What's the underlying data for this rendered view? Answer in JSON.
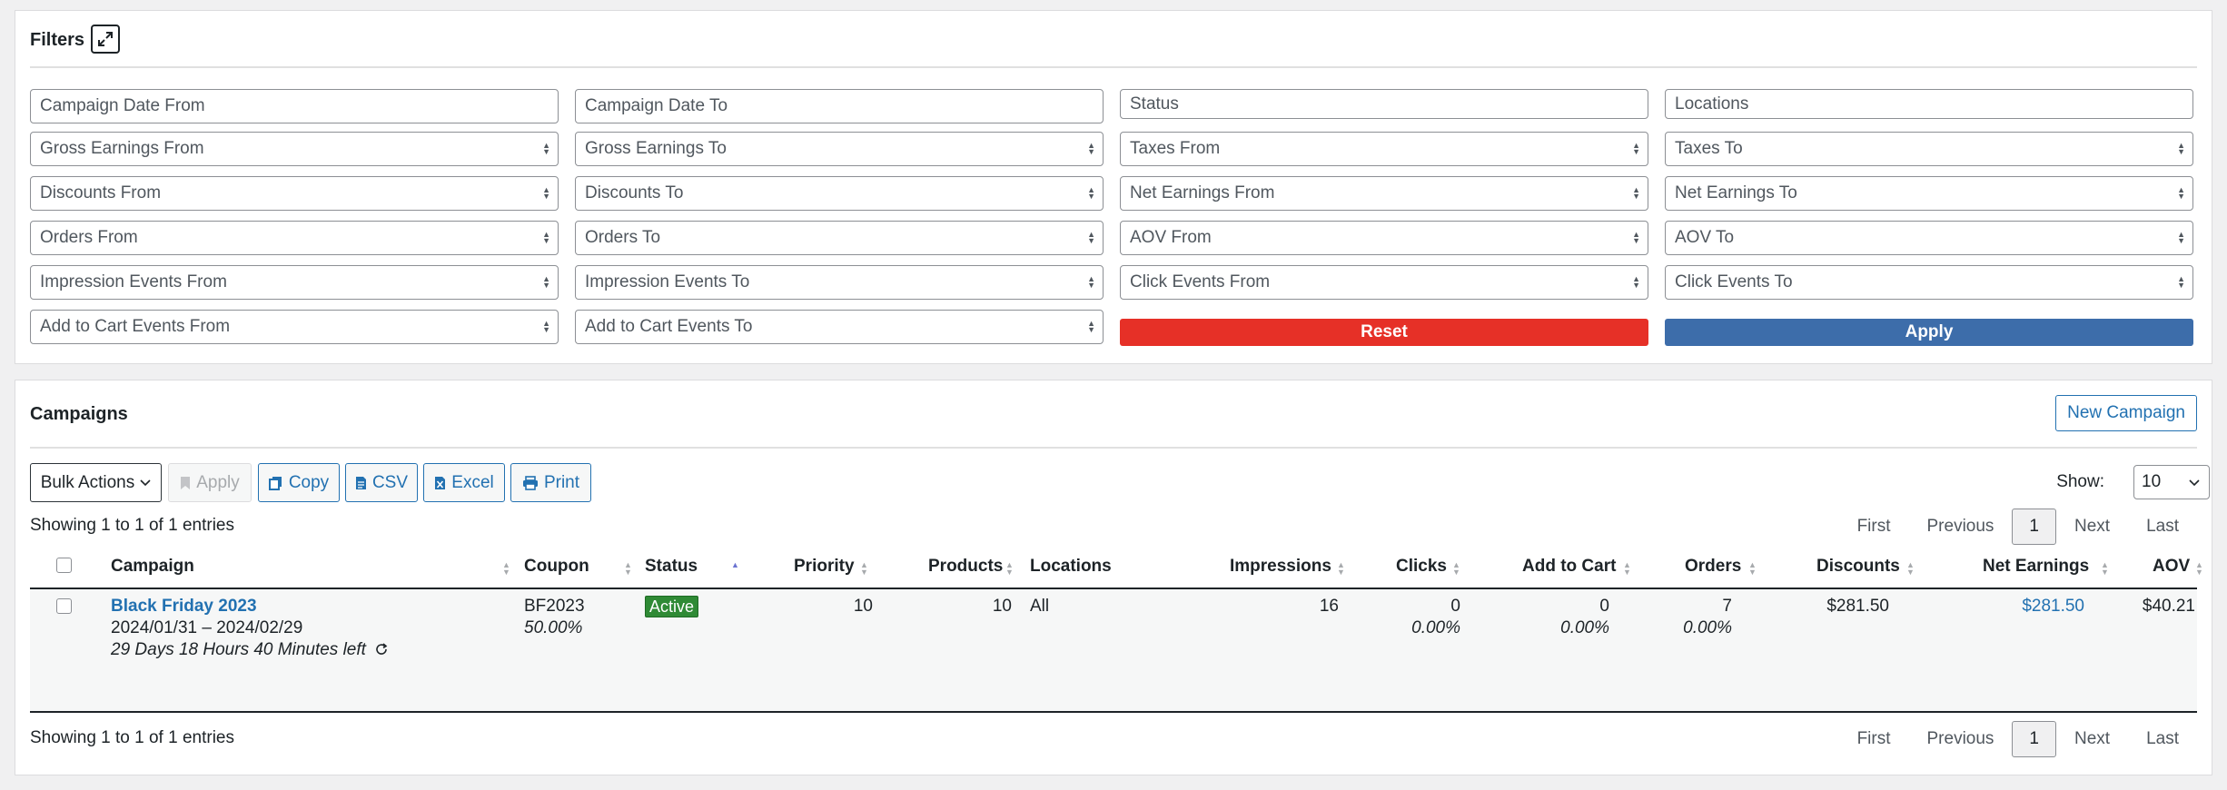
{
  "filters": {
    "title": "Filters",
    "fields": [
      [
        "Campaign Date From",
        "Campaign Date To",
        "Status",
        "Locations"
      ],
      [
        "Gross Earnings From",
        "Gross Earnings To",
        "Taxes From",
        "Taxes To"
      ],
      [
        "Discounts From",
        "Discounts To",
        "Net Earnings From",
        "Net Earnings To"
      ],
      [
        "Orders From",
        "Orders To",
        "AOV From",
        "AOV To"
      ],
      [
        "Impression Events From",
        "Impression Events To",
        "Click Events From",
        "Click Events To"
      ],
      [
        "Add to Cart Events From",
        "Add to Cart Events To"
      ]
    ],
    "reset_label": "Reset",
    "apply_label": "Apply"
  },
  "campaigns": {
    "title": "Campaigns",
    "new_button": "New Campaign",
    "toolbar": {
      "bulk_actions": "Bulk Actions",
      "apply": "Apply",
      "copy": "Copy",
      "csv": "CSV",
      "excel": "Excel",
      "print": "Print",
      "show_label": "Show:",
      "show_value": "10"
    },
    "info_top": "Showing 1 to 1 of 1 entries",
    "info_bottom": "Showing 1 to 1 of 1 entries",
    "pager": {
      "first": "First",
      "previous": "Previous",
      "current": "1",
      "next": "Next",
      "last": "Last"
    },
    "columns": [
      "Campaign",
      "Coupon",
      "Status",
      "Priority",
      "Products",
      "Locations",
      "Impressions",
      "Clicks",
      "Add to Cart",
      "Orders",
      "Discounts",
      "Net Earnings",
      "AOV"
    ],
    "rows": [
      {
        "name": "Black Friday 2023",
        "dates": "2024/01/31 – 2024/02/29",
        "time_left": "29 Days 18 Hours 40 Minutes left",
        "coupon": "BF2023",
        "coupon_pct": "50.00%",
        "status": "Active",
        "priority": "10",
        "products": "10",
        "locations": "All",
        "impressions": "16",
        "clicks": "0",
        "clicks_pct": "0.00%",
        "add_to_cart": "0",
        "add_to_cart_pct": "0.00%",
        "orders": "7",
        "orders_pct": "0.00%",
        "discounts": "$281.50",
        "net_earnings": "$281.50",
        "aov": "$40.21"
      }
    ]
  },
  "colors": {
    "reset": "#e63027",
    "apply": "#3d6daa",
    "link": "#2271b1",
    "active_badge": "#2f8a35"
  }
}
